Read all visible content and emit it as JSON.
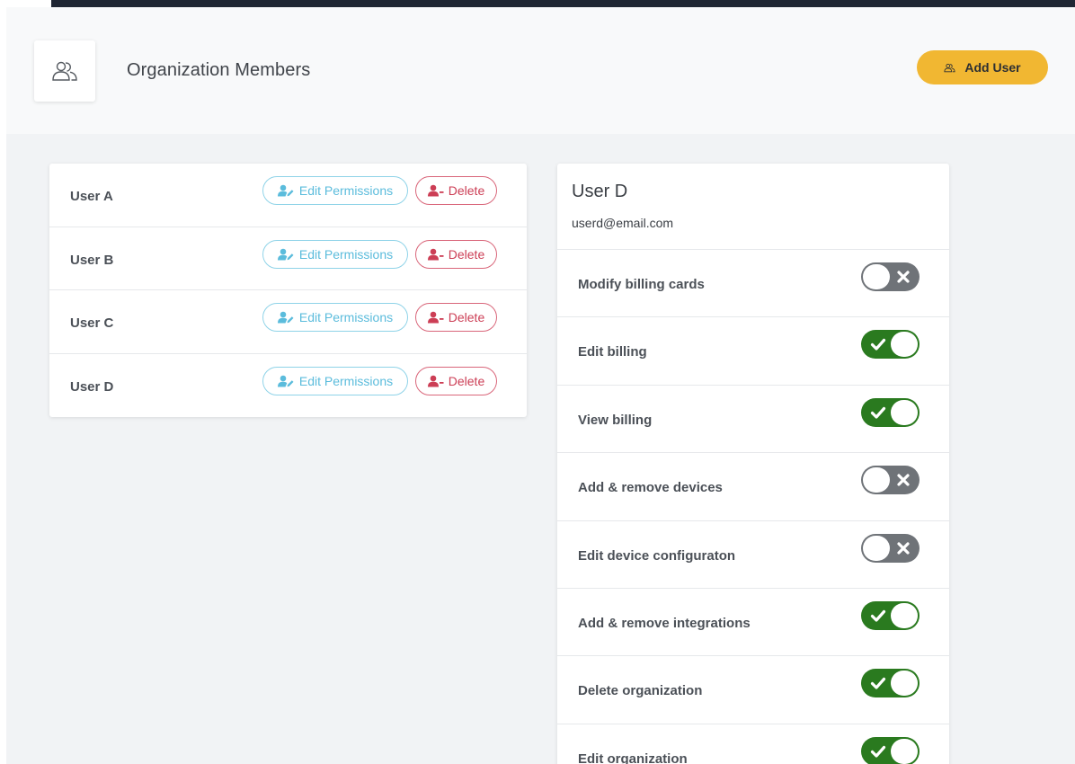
{
  "header": {
    "title": "Organization Members",
    "add_user_label": "Add User",
    "members_icon": "users-outline-icon"
  },
  "users": [
    {
      "name": "User A",
      "edit_label": "Edit Permissions",
      "delete_label": "Delete"
    },
    {
      "name": "User B",
      "edit_label": "Edit Permissions",
      "delete_label": "Delete"
    },
    {
      "name": "User C",
      "edit_label": "Edit Permissions",
      "delete_label": "Delete"
    },
    {
      "name": "User D",
      "edit_label": "Edit Permissions",
      "delete_label": "Delete"
    }
  ],
  "selected_user": {
    "name": "User D",
    "email": "userd@email.com"
  },
  "permissions": [
    {
      "label": "Modify billing cards",
      "enabled": false
    },
    {
      "label": "Edit billing",
      "enabled": true
    },
    {
      "label": "View billing",
      "enabled": true
    },
    {
      "label": "Add & remove devices",
      "enabled": false
    },
    {
      "label": "Edit device configuraton",
      "enabled": false
    },
    {
      "label": "Add & remove integrations",
      "enabled": true
    },
    {
      "label": "Delete organization",
      "enabled": true
    },
    {
      "label": "Edit organization",
      "enabled": true
    }
  ],
  "colors": {
    "accent": "#f1b732",
    "edit": "#5bbcdc",
    "delete": "#cc3e55",
    "toggle_on": "#2a7a1f",
    "toggle_off": "#6f7378"
  }
}
